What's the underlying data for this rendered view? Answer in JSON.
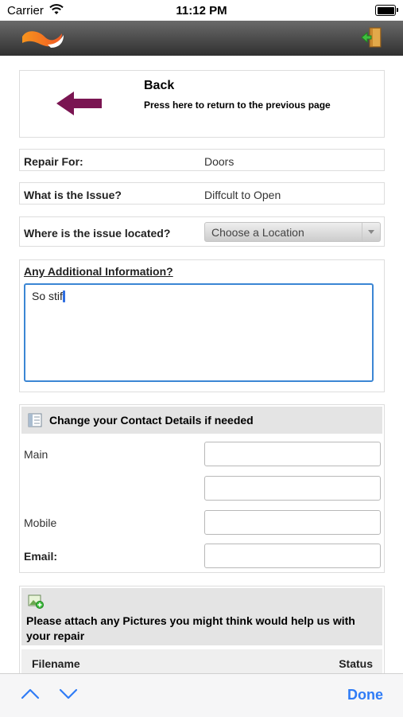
{
  "status_bar": {
    "carrier": "Carrier",
    "time": "11:12 PM"
  },
  "header": {
    "logo_icon": "fox-tail-logo",
    "exit_icon": "exit-door-icon"
  },
  "back": {
    "title": "Back",
    "subtitle": "Press here to return to the previous page",
    "arrow_color": "#7a1552"
  },
  "repair": {
    "label": "Repair For:",
    "value": "Doors"
  },
  "issue": {
    "label": "What is the Issue?",
    "value": "Diffcult to Open"
  },
  "location": {
    "label": "Where is the issue located?",
    "selected": "Choose a Location"
  },
  "additional": {
    "label": "Any Additional Information?",
    "text": "So stif"
  },
  "contact": {
    "heading": "Change your Contact Details if needed",
    "main_label": "Main",
    "mobile_label": "Mobile",
    "email_label": "Email:"
  },
  "pictures": {
    "heading": "Please attach any Pictures you might think would help us with your repair",
    "col_filename": "Filename",
    "col_status": "Status"
  },
  "keyboard_bar": {
    "done": "Done",
    "accent": "#2f7cf6"
  }
}
